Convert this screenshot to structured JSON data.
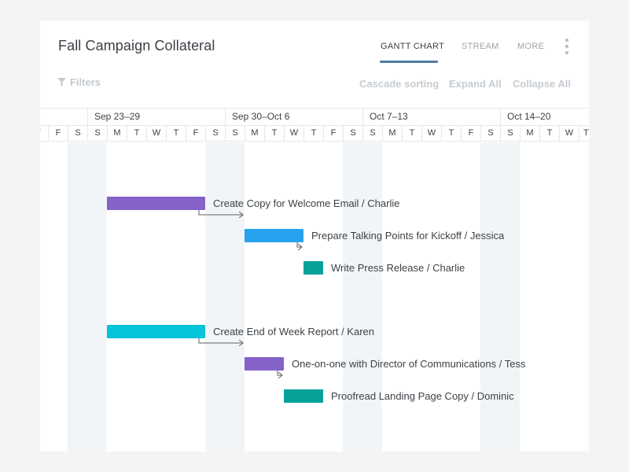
{
  "header": {
    "title": "Fall Campaign Collateral",
    "tabs": [
      {
        "label": "GANTT CHART",
        "active": true
      },
      {
        "label": "STREAM",
        "active": false
      },
      {
        "label": "MORE",
        "active": false
      }
    ]
  },
  "toolbar": {
    "filters_label": "Filters",
    "cascade_sorting": "Cascade sorting",
    "expand_all": "Expand All",
    "collapse_all": "Collapse All"
  },
  "timeline": {
    "weeks": [
      "Sep 23–29",
      "Sep 30–Oct 6",
      "Oct 7–13",
      "Oct 14–20"
    ],
    "day_letters": [
      "T",
      "F",
      "S",
      "S",
      "M",
      "T",
      "W",
      "T",
      "F",
      "S",
      "S",
      "M",
      "T",
      "W",
      "T",
      "F",
      "S",
      "S",
      "M",
      "T",
      "W",
      "T",
      "F",
      "S",
      "S",
      "M",
      "T",
      "W",
      "T"
    ]
  },
  "tasks": [
    {
      "label": "Create Copy for Welcome Email / Charlie",
      "color": "#8462c8"
    },
    {
      "label": "Prepare Talking Points for Kickoff / Jessica",
      "color": "#27a2ef"
    },
    {
      "label": "Write Press Release / Charlie",
      "color": "#07a198"
    },
    {
      "label": "Create End of Week Report / Karen",
      "color": "#04c4da"
    },
    {
      "label": "One-on-one with Director of Communications / Tess",
      "color": "#8462c8"
    },
    {
      "label": "Proofread Landing Page Copy / Dominic",
      "color": "#07a198"
    }
  ],
  "colors": {
    "tab_active_underline": "#4f7ca8",
    "weekend_shade": "#f1f5f7"
  },
  "icons": {
    "filter": "filter-icon",
    "more": "kebab-menu-icon",
    "dependency_arrow": "arrow-right-icon"
  }
}
